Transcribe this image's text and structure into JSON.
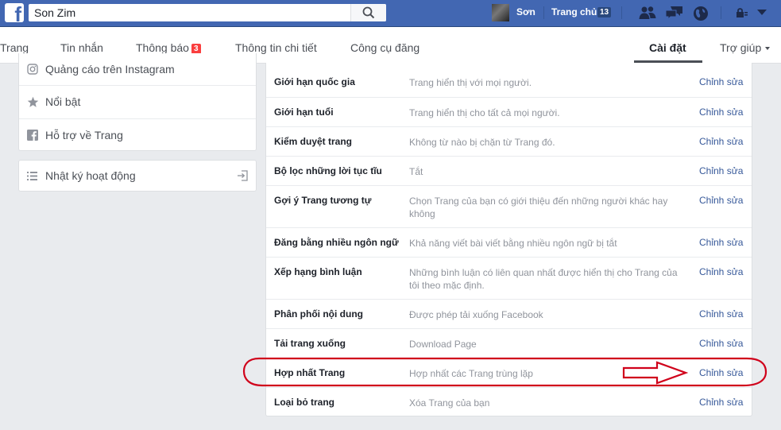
{
  "topbar": {
    "search_value": "Son Zim",
    "user_name": "Sơn",
    "home_label": "Trang chủ",
    "home_count": "13"
  },
  "tabs": {
    "page": "Trang",
    "messages": "Tin nhắn",
    "notifications": "Thông báo",
    "notifications_count": "3",
    "insights": "Thông tin chi tiết",
    "publishing_tools": "Công cụ đăng",
    "settings": "Cài đặt",
    "help": "Trợ giúp"
  },
  "sidebar": {
    "items": [
      {
        "label": "Quảng cáo trên Instagram",
        "icon": "instagram-icon"
      },
      {
        "label": "Nổi bật",
        "icon": "star-icon"
      },
      {
        "label": "Hỗ trợ về Trang",
        "icon": "facebook-icon"
      }
    ],
    "activity_log": "Nhật ký hoạt động"
  },
  "settings": {
    "edit_label": "Chỉnh sửa",
    "rows": [
      {
        "label": "Giới hạn quốc gia",
        "desc": "Trang hiển thị với mọi người."
      },
      {
        "label": "Giới hạn tuổi",
        "desc": "Trang hiển thị cho tất cả mọi người."
      },
      {
        "label": "Kiểm duyệt trang",
        "desc": "Không từ nào bị chặn từ Trang đó."
      },
      {
        "label": "Bộ lọc những lời tục tĩu",
        "desc": "Tắt"
      },
      {
        "label": "Gợi ý Trang tương tự",
        "desc": "Chọn Trang của bạn có giới thiệu đến những người khác hay không"
      },
      {
        "label": "Đăng bằng nhiều ngôn ngữ",
        "desc": "Khả năng viết bài viết bằng nhiều ngôn ngữ bị tắt"
      },
      {
        "label": "Xếp hạng bình luận",
        "desc": "Những bình luận có liên quan nhất được hiển thị cho Trang của tôi theo mặc định."
      },
      {
        "label": "Phân phối nội dung",
        "desc": "Được phép tải xuống Facebook"
      },
      {
        "label": "Tải trang xuống",
        "desc": "Download Page"
      },
      {
        "label": "Hợp nhất Trang",
        "desc": "Hợp nhất các Trang trùng lặp"
      },
      {
        "label": "Loại bỏ trang",
        "desc": "Xóa Trang của bạn"
      }
    ]
  },
  "colors": {
    "facebook_blue": "#4267b2",
    "link": "#365899",
    "annotation_red": "#d0021b",
    "badge_red": "#fa3e3e"
  }
}
